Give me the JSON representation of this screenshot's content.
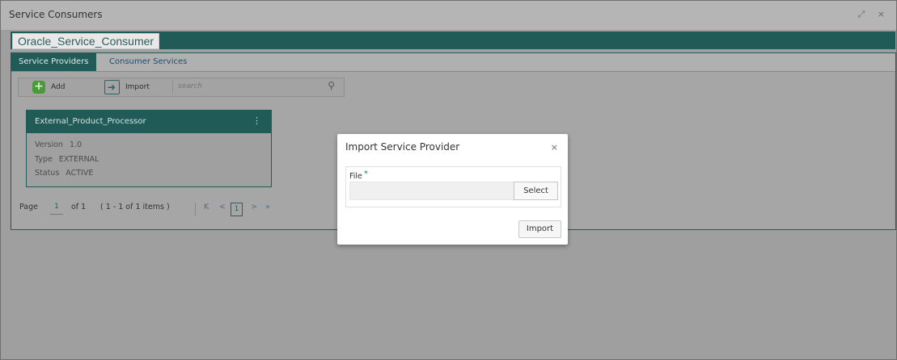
{
  "window": {
    "title": "Service Consumers",
    "controls": "↗↙ ×"
  },
  "consumer": {
    "name": "Oracle_Service_Consumer"
  },
  "tabs": [
    {
      "label": "Service Providers",
      "active": true
    },
    {
      "label": "Consumer Services",
      "active": false
    }
  ],
  "toolbar": {
    "add_label": "Add",
    "import_label": "Import",
    "search_placeholder": "search"
  },
  "card": {
    "title": "External_Product_Processor",
    "rows": [
      {
        "label": "Version",
        "value": "1.0"
      },
      {
        "label": "Type",
        "value": "EXTERNAL"
      },
      {
        "label": "Status",
        "value": "ACTIVE"
      }
    ]
  },
  "pager": {
    "page_label": "Page",
    "page_value": "1",
    "of_text": "of 1",
    "range_text": "( 1 - 1 of 1 items )",
    "first": "K",
    "prev": "<",
    "current": "1",
    "next": ">",
    "last": "»"
  },
  "dialog": {
    "title": "Import Service Provider",
    "file_label": "File",
    "required": "*",
    "select_label": "Select",
    "import_label": "Import"
  },
  "colors": {
    "accent": "#205b58",
    "overlay": "#a9a9a9"
  }
}
